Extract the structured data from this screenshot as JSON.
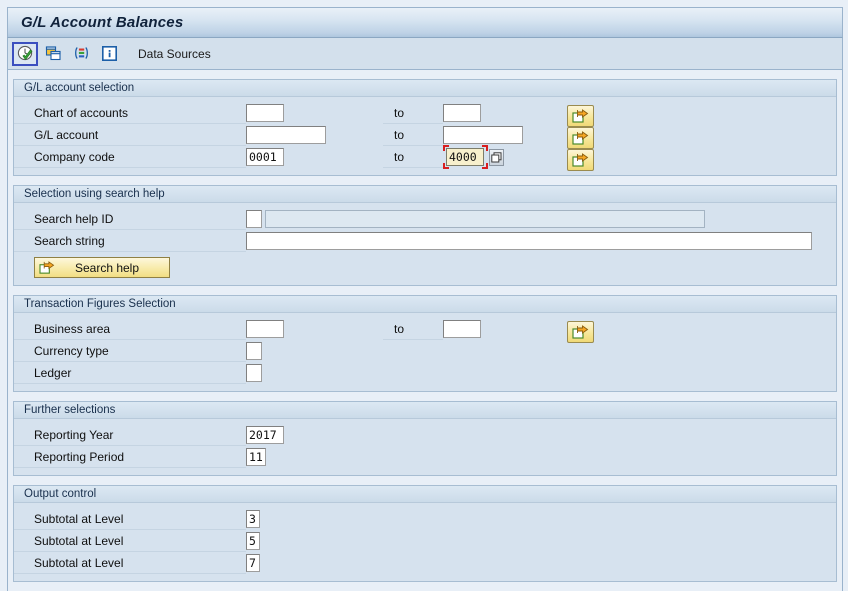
{
  "window": {
    "title": "G/L Account Balances"
  },
  "toolbar": {
    "buttons": [
      {
        "name": "execute-icon",
        "tooltip": "Execute",
        "focused": true
      },
      {
        "name": "get-variant-icon",
        "tooltip": "Get Variant",
        "focused": false
      },
      {
        "name": "selection-options-icon",
        "tooltip": "Selection Options",
        "focused": false
      },
      {
        "name": "information-icon",
        "tooltip": "Information",
        "focused": false
      }
    ],
    "data_sources_label": "Data Sources"
  },
  "sections": {
    "gl_account_selection": {
      "title": "G/L account selection",
      "to_label": "to",
      "rows": [
        {
          "label": "Chart of accounts",
          "from_value": "",
          "to_value": "",
          "from_width": "w-xs",
          "to_width": "w-xs"
        },
        {
          "label": "G/L account",
          "from_value": "",
          "to_value": "",
          "from_width": "w-md",
          "to_width": "w-md"
        },
        {
          "label": "Company code",
          "from_value": "0001",
          "to_value": "4000",
          "from_width": "w-xs",
          "to_width": "w-xs"
        }
      ]
    },
    "selection_using_search_help": {
      "title": "Selection using search help",
      "search_help_id_label": "Search help ID",
      "search_help_id_value": "",
      "search_help_desc_value": "",
      "search_string_label": "Search string",
      "search_string_value": "",
      "search_help_button_label": "Search help"
    },
    "transaction_figures_selection": {
      "title": "Transaction Figures Selection",
      "to_label": "to",
      "rows": [
        {
          "label": "Business area",
          "from_value": "",
          "to_value": "",
          "has_to": true
        },
        {
          "label": "Currency type",
          "from_value": "",
          "to_value": "",
          "has_to": false
        },
        {
          "label": "Ledger",
          "from_value": "",
          "to_value": "",
          "has_to": false
        }
      ]
    },
    "further_selections": {
      "title": "Further selections",
      "rows": [
        {
          "label": "Reporting Year",
          "value": "2017"
        },
        {
          "label": "Reporting Period",
          "value": "11"
        }
      ]
    },
    "output_control": {
      "title": "Output control",
      "rows": [
        {
          "label": "Subtotal at Level",
          "value": "3"
        },
        {
          "label": "Subtotal at Level",
          "value": "5"
        },
        {
          "label": "Subtotal at Level",
          "value": "7"
        }
      ]
    }
  },
  "colors": {
    "title_bar_gradient_top": "#e9f1f8",
    "title_bar_gradient_bottom": "#aec6de",
    "page_background": "#e8eff7",
    "group_background": "#d6e2ee",
    "focus_outline": "#3b4fbf",
    "field_focus_corner": "#d81f1f",
    "button_yellow": "#f2de83"
  }
}
